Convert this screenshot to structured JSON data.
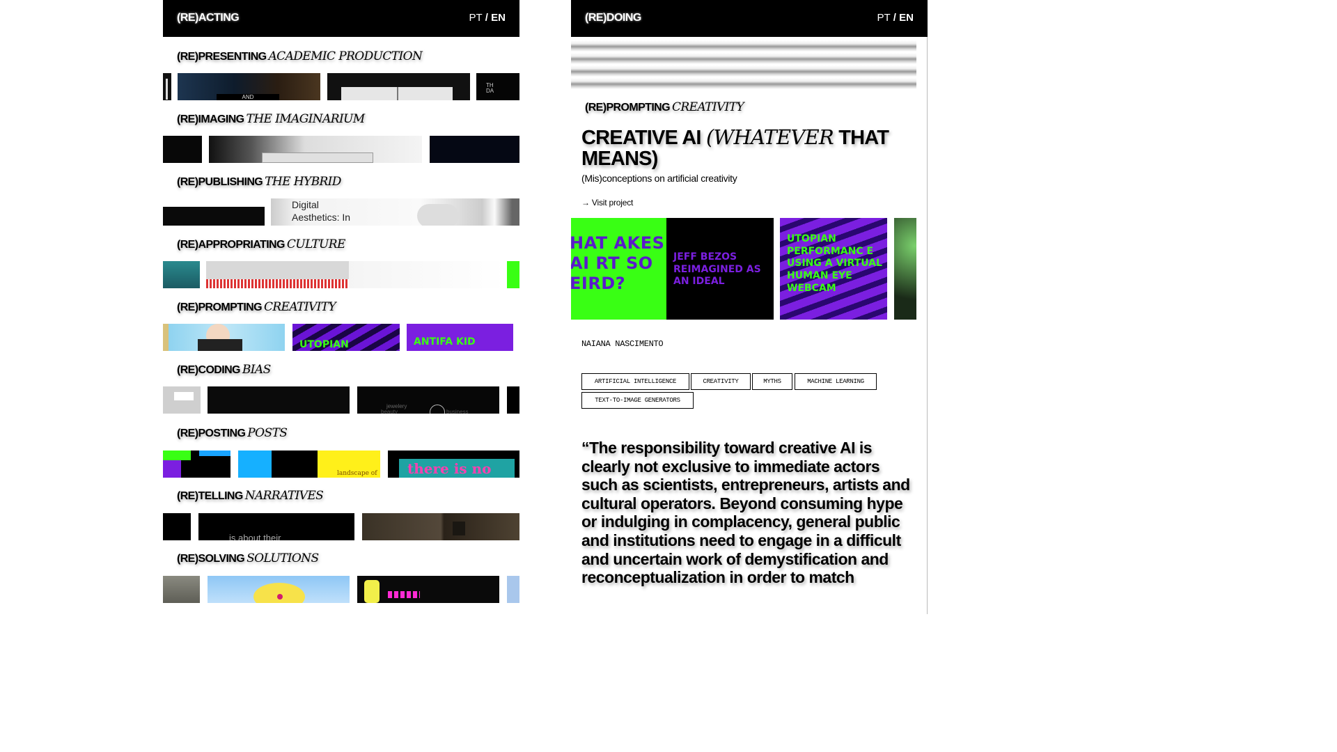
{
  "left_panel": {
    "brand": "(RE)ACTING",
    "lang": {
      "pt": "PT",
      "sep": " / ",
      "en": "EN"
    },
    "sections": [
      {
        "prefix": "(RE)PRESENTING",
        "title": "ACADEMIC PRODUCTION",
        "thumb_texts": [
          "AND",
          "TH",
          "DA"
        ]
      },
      {
        "prefix": "(RE)IMAGING",
        "title": "THE IMAGINARIUM",
        "thumb_texts": []
      },
      {
        "prefix": "(RE)PUBLISHING",
        "title": "THE HYBRID",
        "thumb_texts": [
          "Digital Aesthetics: In"
        ]
      },
      {
        "prefix": "(RE)APPROPRIATING",
        "title": "CULTURE",
        "thumb_texts": []
      },
      {
        "prefix": "(RE)PROMPTING",
        "title": "CREATIVITY",
        "thumb_texts": [
          "UTOPIAN",
          "ANTIFA KID"
        ]
      },
      {
        "prefix": "(RE)CODING",
        "title": "BIAS",
        "thumb_texts": [
          "jewelery",
          "beauty",
          "business"
        ]
      },
      {
        "prefix": "(RE)POSTING",
        "title": "POSTS",
        "thumb_texts": [
          "landscape of",
          "there is no"
        ]
      },
      {
        "prefix": "(RE)TELLING",
        "title": "NARRATIVES",
        "thumb_texts": [
          "is about their"
        ]
      },
      {
        "prefix": "(RE)SOLVING",
        "title": "SOLUTIONS",
        "thumb_texts": []
      }
    ]
  },
  "right_panel": {
    "brand": "(RE)DOING",
    "lang": {
      "pt": "PT",
      "sep": " / ",
      "en": "EN"
    },
    "kicker_prefix": "(RE)PROMPTING",
    "kicker_title": "CREATIVITY",
    "headline_a": "CREATIVE AI",
    "headline_b": "(WHATEVER",
    "headline_c": "THAT MEANS)",
    "subtitle": "(Mis)conceptions on artificial creativity",
    "visit_link": "→ Visit project",
    "cards": [
      {
        "text": "HAT AKES AI RT SO EIRD?"
      },
      {
        "text": "JEFF BEZOS REIMAGINED AS AN IDEAL"
      },
      {
        "text": "UTOPIAN PERFORMANC E USING A VIRTUAL HUMAN EYE WEBCAM"
      }
    ],
    "author": "NAIANA NASCIMENTO",
    "tags": [
      "ARTIFICIAL INTELLIGENCE",
      "CREATIVITY",
      "MYTHS",
      "MACHINE LEARNING",
      "TEXT-TO-IMAGE GENERATORS"
    ],
    "quote": "“The responsibility toward creative AI is clearly not exclusive to immediate actors such as scientists, entrepreneurs, artists and cultural operators. Beyond consuming hype or indulging in complacency, general public and institutions need to engage in a difficult and uncertain work of demystification and reconceptualization in order to match"
  },
  "colors": {
    "neon_green": "#39ff14",
    "purple": "#7b1fe0",
    "black": "#000000"
  }
}
